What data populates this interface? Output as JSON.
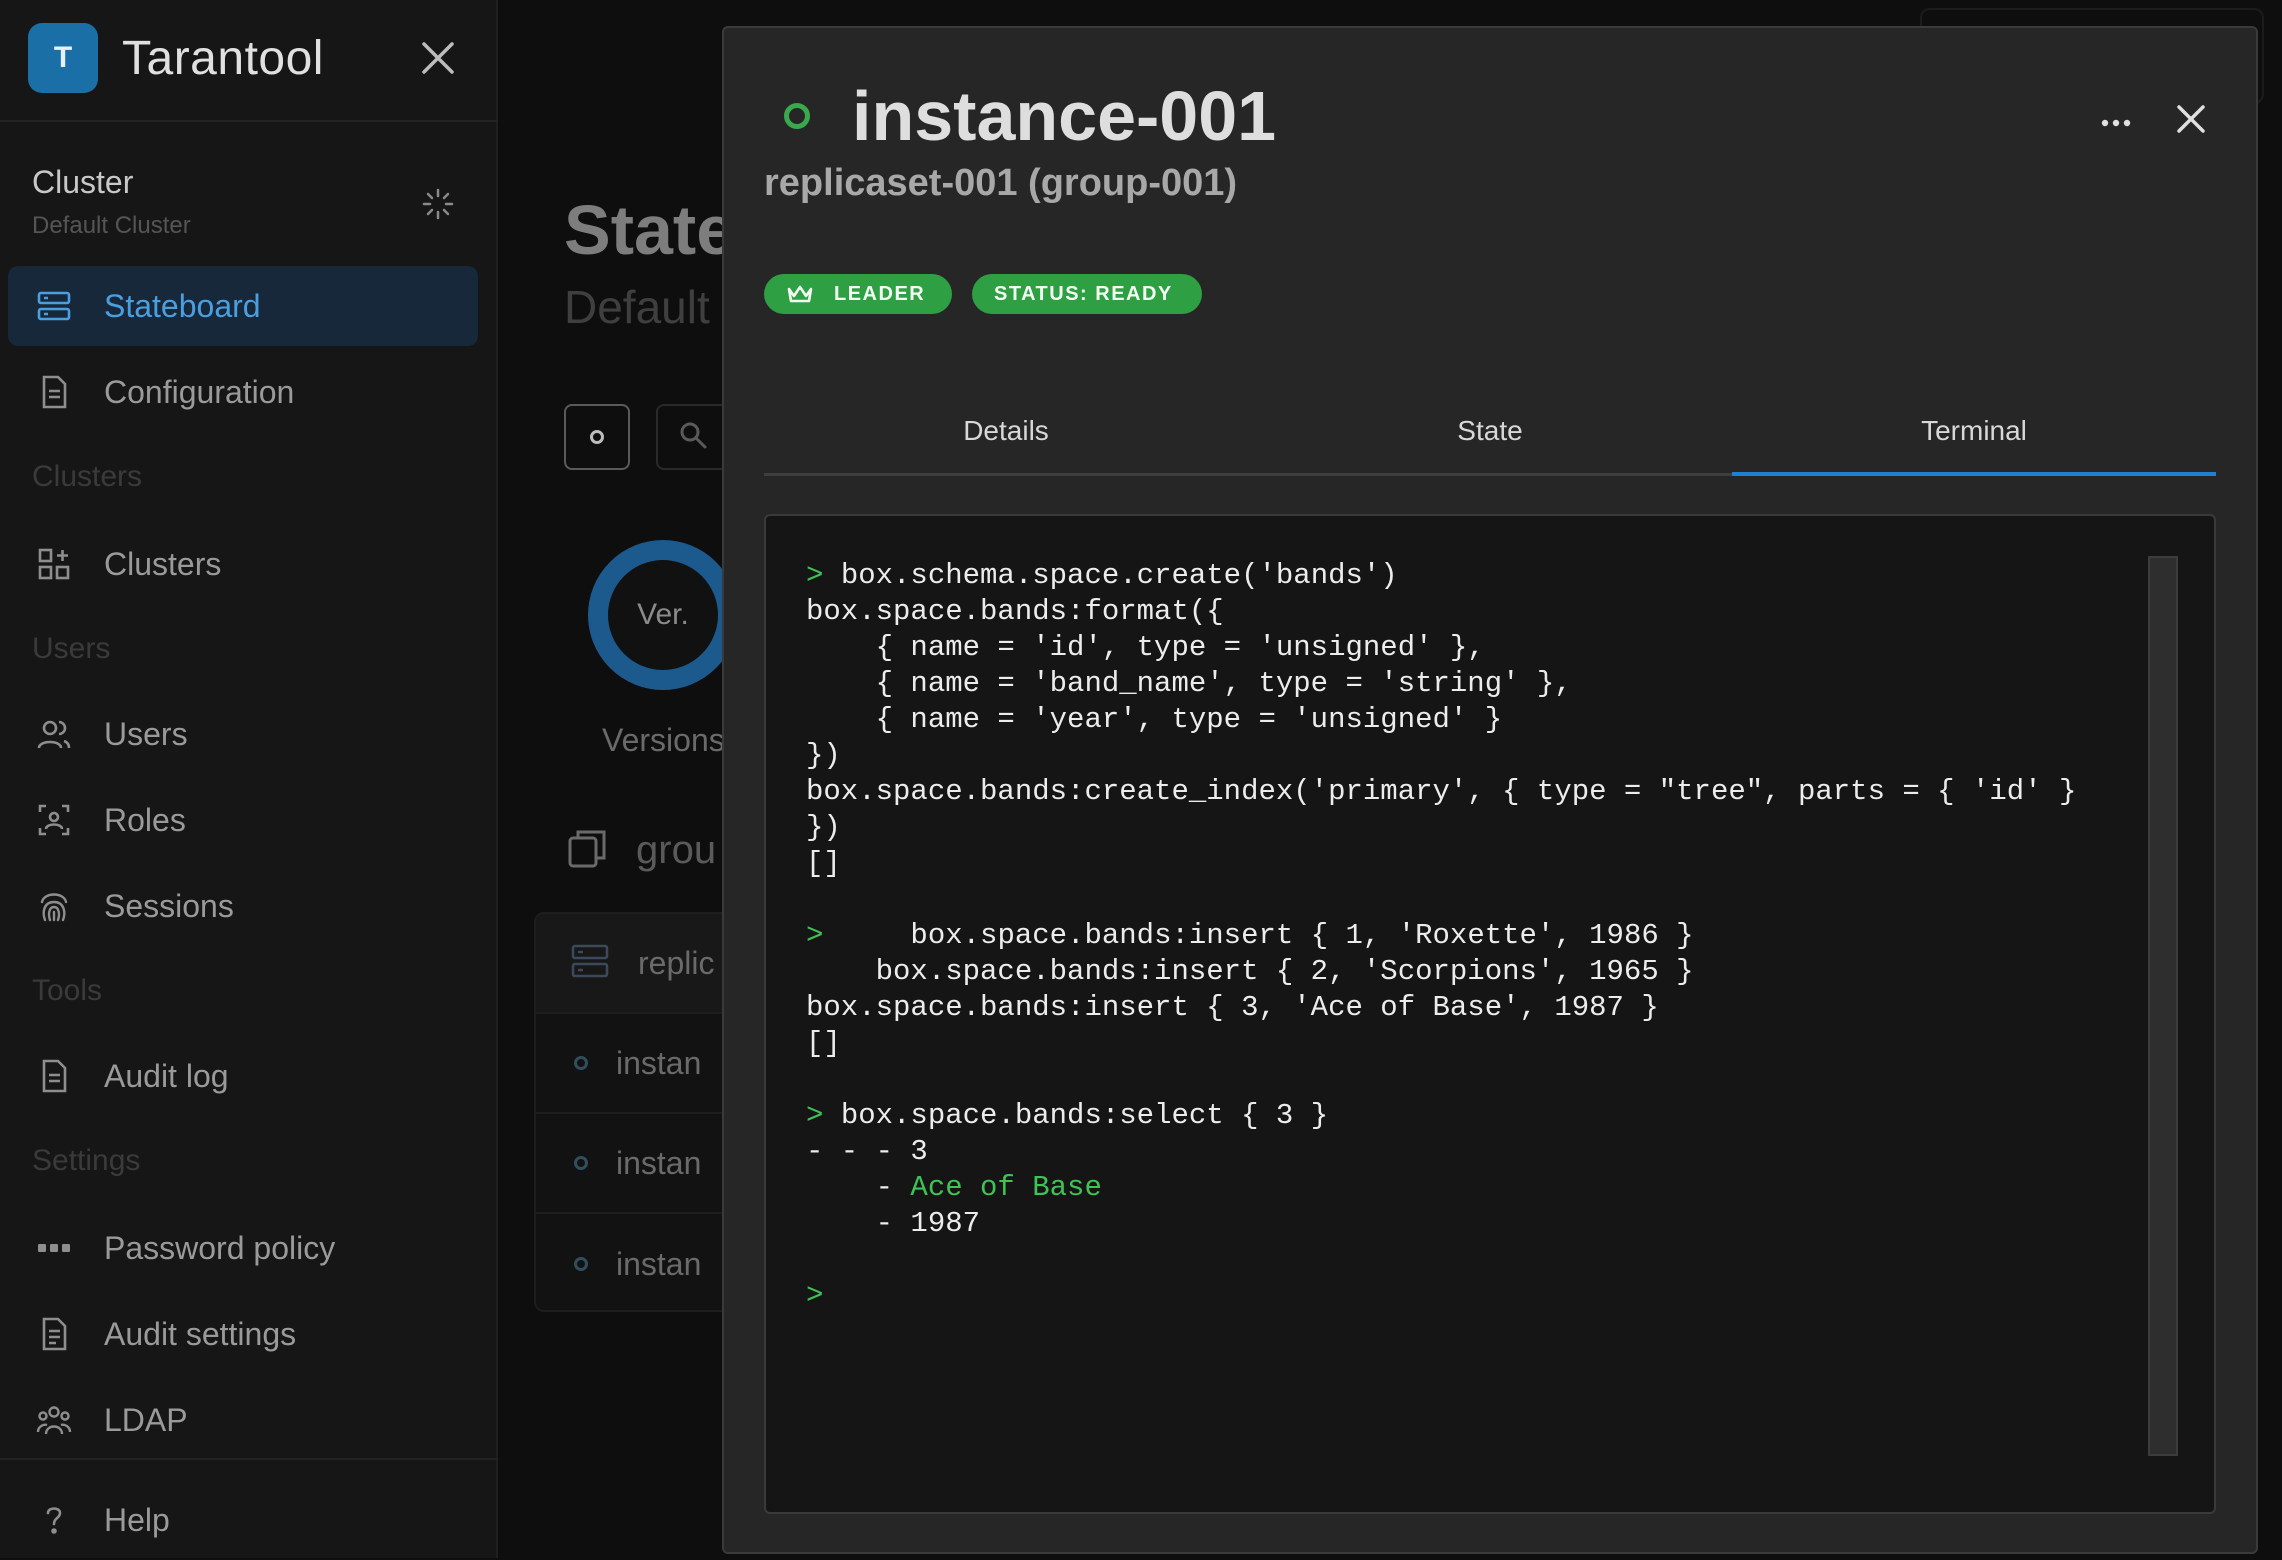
{
  "app": {
    "name": "Tarantool",
    "logo_letter": "T"
  },
  "sidebar": {
    "cluster_title": "Cluster",
    "cluster_subtitle": "Default Cluster",
    "items": [
      {
        "label": "Stateboard",
        "icon": "stateboard-icon",
        "active": true
      },
      {
        "label": "Configuration",
        "icon": "document-icon"
      },
      {
        "label": "Clusters",
        "icon": "grid-plus-icon"
      },
      {
        "label": "Users",
        "icon": "users-icon"
      },
      {
        "label": "Roles",
        "icon": "role-badge-icon"
      },
      {
        "label": "Sessions",
        "icon": "fingerprint-icon"
      },
      {
        "label": "Audit log",
        "icon": "document-icon"
      },
      {
        "label": "Password policy",
        "icon": "password-dots-icon"
      },
      {
        "label": "Audit settings",
        "icon": "document-settings-icon"
      },
      {
        "label": "LDAP",
        "icon": "group-icon"
      },
      {
        "label": "Help",
        "icon": "question-icon"
      }
    ],
    "sections": {
      "clusters": "Clusters",
      "users": "Users",
      "tools": "Tools",
      "settings": "Settings"
    }
  },
  "main": {
    "title": "State",
    "subtitle": "Default C",
    "donut_label": "Ver.",
    "versions_label": "Versions",
    "group_label": "grou",
    "list": {
      "head": "replic",
      "rows": [
        "instan",
        "instan",
        "instan"
      ]
    }
  },
  "drawer": {
    "title": "instance-001",
    "subtitle": "replicaset-001 (group-001)",
    "badges": {
      "leader": "LEADER",
      "status": "STATUS: READY"
    },
    "tabs": [
      "Details",
      "State",
      "Terminal"
    ],
    "active_tab": "Terminal",
    "colors": {
      "accent": "#1f7fd0",
      "ready": "#2ea043"
    },
    "terminal": {
      "prompt": ">",
      "l1": "box.schema.space.create('bands')",
      "l2": "box.space.bands:format({",
      "l3": "    { name = 'id', type = 'unsigned' },",
      "l4": "    { name = 'band_name', type = 'string' },",
      "l5": "    { name = 'year', type = 'unsigned' }",
      "l6": "})",
      "l7": "box.space.bands:create_index('primary', { type = \"tree\", parts = { 'id' }",
      "l8": "})",
      "l9": "[]",
      "l10": "    box.space.bands:insert { 1, 'Roxette', 1986 }",
      "l11": "    box.space.bands:insert { 2, 'Scorpions', 1965 }",
      "l12": "box.space.bands:insert { 3, 'Ace of Base', 1987 }",
      "l13": "[]",
      "l14": "box.space.bands:select { 3 }",
      "l15a": "- - - ",
      "l15b": "3",
      "l16a": "    - ",
      "l16b": "Ace of Base",
      "l17a": "    - ",
      "l17b": "1987"
    }
  }
}
